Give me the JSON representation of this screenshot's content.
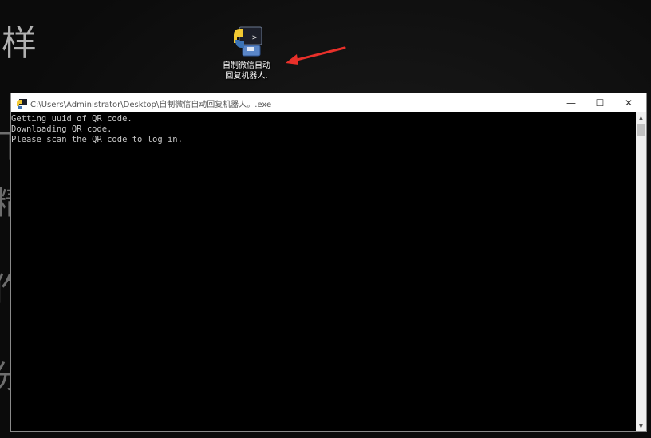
{
  "desktop": {
    "icon": {
      "label_line1": "自制微信自动",
      "label_line2": "回复机器人."
    },
    "calligraphy": [
      "样",
      "下",
      "精",
      "作",
      "分"
    ]
  },
  "window": {
    "title": "C:\\Users\\Administrator\\Desktop\\自制微信自动回复机器人。.exe",
    "minimize": "—",
    "maximize": "☐",
    "close": "✕"
  },
  "console": {
    "lines": [
      "Getting uuid of QR code.",
      "Downloading QR code.",
      "Please scan the QR code to log in."
    ]
  },
  "colors": {
    "arrow": "#e8302a",
    "console_bg": "#000000",
    "console_text": "#c8c8c8"
  }
}
